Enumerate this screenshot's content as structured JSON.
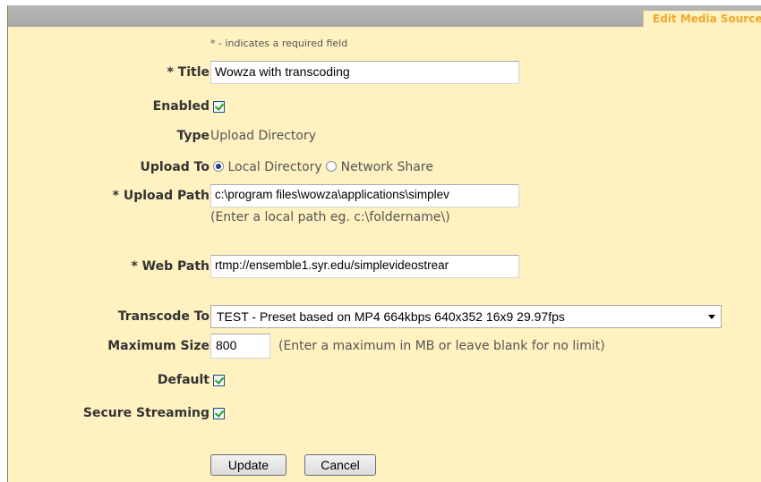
{
  "header": {
    "tab_label": "Edit Media Source"
  },
  "form": {
    "required_note": "* - indicates a required field",
    "title": {
      "label": "* Title",
      "value": "Wowza with transcoding"
    },
    "enabled": {
      "label": "Enabled",
      "checked": true
    },
    "type": {
      "label": "Type",
      "value": "Upload Directory"
    },
    "upload_to": {
      "label": "Upload To",
      "options": [
        "Local Directory",
        "Network Share"
      ],
      "selected": "Local Directory"
    },
    "upload_path": {
      "label": "* Upload Path",
      "value": "c:\\program files\\wowza\\applications\\simplev",
      "hint": "(Enter a local path eg. c:\\foldername\\)"
    },
    "web_path": {
      "label": "* Web Path",
      "value": "rtmp://ensemble1.syr.edu/simplevideostrear"
    },
    "transcode_to": {
      "label": "Transcode To",
      "value": "TEST - Preset based on MP4 664kbps 640x352 16x9 29.97fps"
    },
    "maximum_size": {
      "label": "Maximum Size",
      "value": "800",
      "hint": "(Enter a maximum in MB or leave blank for no limit)"
    },
    "default": {
      "label": "Default",
      "checked": true
    },
    "secure_streaming": {
      "label": "Secure Streaming",
      "checked": true
    },
    "update_label": "Update",
    "cancel_label": "Cancel"
  }
}
